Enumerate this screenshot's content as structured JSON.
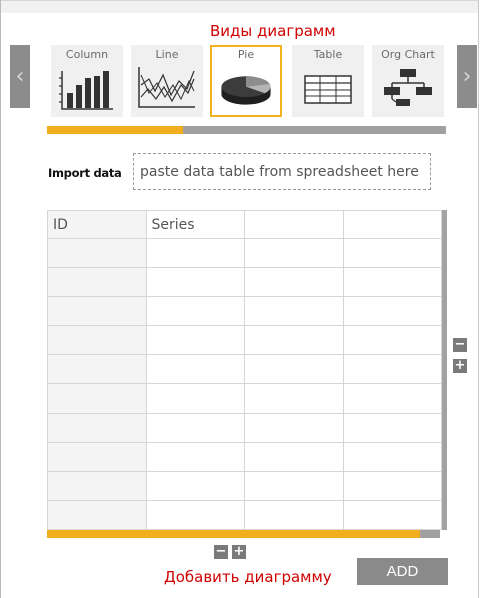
{
  "annotations": {
    "chart_types_caption": "Виды диаграмм",
    "add_chart_caption": "Добавить диаграмму"
  },
  "carousel": {
    "prev_icon": "‹",
    "next_icon": "›",
    "types": [
      {
        "label": "Column",
        "icon": "column-chart-icon",
        "selected": false
      },
      {
        "label": "Line",
        "icon": "line-chart-icon",
        "selected": false
      },
      {
        "label": "Pie",
        "icon": "pie-chart-icon",
        "selected": true
      },
      {
        "label": "Table",
        "icon": "table-chart-icon",
        "selected": false
      },
      {
        "label": "Org Chart",
        "icon": "org-chart-icon",
        "selected": false
      }
    ],
    "progress_fraction": 0.34
  },
  "import": {
    "label": "Import data",
    "placeholder": "paste data table from spreadsheet here",
    "value": ""
  },
  "table": {
    "headers": [
      "ID",
      "Series",
      "",
      ""
    ],
    "rows": [
      [
        "",
        "",
        "",
        ""
      ],
      [
        "",
        "",
        "",
        ""
      ],
      [
        "",
        "",
        "",
        ""
      ],
      [
        "",
        "",
        "",
        ""
      ],
      [
        "",
        "",
        "",
        ""
      ],
      [
        "",
        "",
        "",
        ""
      ],
      [
        "",
        "",
        "",
        ""
      ],
      [
        "",
        "",
        "",
        ""
      ],
      [
        "",
        "",
        "",
        ""
      ],
      [
        "",
        "",
        "",
        ""
      ]
    ],
    "h_scroll_fraction": 0.95
  },
  "controls": {
    "minus": "−",
    "plus": "+",
    "add_label": "ADD"
  },
  "colors": {
    "accent": "#f2ae1c",
    "annotation": "#d10000",
    "gray_button": "#8a8a8a"
  }
}
